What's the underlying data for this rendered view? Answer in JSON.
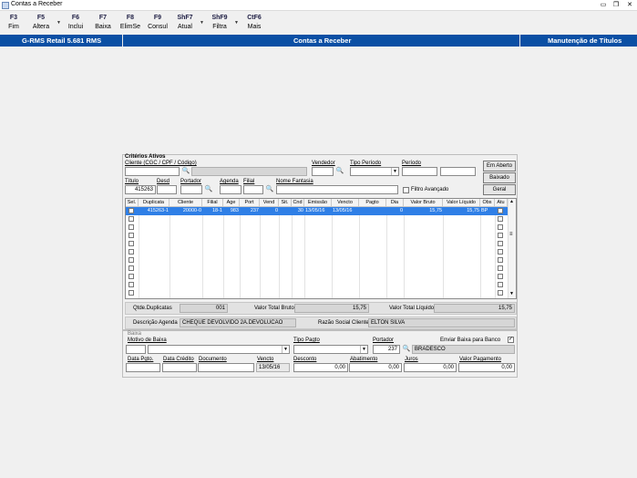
{
  "window": {
    "title": "Contas a Receber"
  },
  "toolbar": [
    {
      "key": "F3",
      "label": "Fim"
    },
    {
      "key": "F5",
      "label": "Altera"
    },
    {
      "key": "F6",
      "label": "Inclui"
    },
    {
      "key": "F7",
      "label": "Baixa"
    },
    {
      "key": "F8",
      "label": "ElimSe"
    },
    {
      "key": "F9",
      "label": "Consul"
    },
    {
      "key": "ShF7",
      "label": "Atual"
    },
    {
      "key": "ShF9",
      "label": "Filtra"
    },
    {
      "key": "CtF6",
      "label": "Mais"
    }
  ],
  "header": {
    "left": "G-RMS Retail 5.681 RMS",
    "center": "Contas a Receber",
    "right": "Manutenção de Títulos"
  },
  "criteria": {
    "title": "Critérios Ativos",
    "cliente_label": "Cliente (CGC / CPF / Código)",
    "vendedor_label": "Vendedor",
    "tipo_periodo_label": "Tipo Período",
    "periodo_label": "Período",
    "titulo_label": "Título",
    "titulo_value": "415263",
    "desd_label": "Desd",
    "portador_label": "Portador",
    "agenda_label": "Agenda",
    "filial_label": "Filial",
    "nome_fantasia_label": "Nome Fantasia",
    "filtro_avancado_label": "Filtro Avançado",
    "btn_em_aberto": "Em Aberto",
    "btn_baixado": "Baixado",
    "btn_geral": "Geral"
  },
  "grid": {
    "columns": [
      "Sel.",
      "Duplicata",
      "Cliente",
      "Filial",
      "Age",
      "Port",
      "Vend",
      "Sit.",
      "Cnd",
      "Emissão",
      "Vencto",
      "Pagto",
      "Dia",
      "Valor Bruto",
      "Valor Líquido",
      "Obs",
      "Atu"
    ],
    "rows": [
      {
        "duplicata": "415263-1",
        "cliente": "20000-0",
        "filial": "18-1",
        "age": "983",
        "port": "237",
        "vend": "0",
        "cnd": "30",
        "emissao": "13/05/16",
        "vencto": "13/05/16",
        "pagto": "",
        "dia": "0",
        "bruto": "15,75",
        "liquido": "15,75",
        "obs": "BP"
      }
    ]
  },
  "totals": {
    "qtde_label": "Qtde.Duplicatas",
    "qtde_value": "001",
    "bruto_label": "Valor Total Bruto",
    "bruto_value": "15,75",
    "liquido_label": "Valor Total Líquido",
    "liquido_value": "15,75",
    "descricao_label": "Descrição Agenda",
    "descricao_value": "CHEQUE DEVOLVIDO 2A.DEVOLUCAO",
    "razao_label": "Razão Social Cliente",
    "razao_value": "ELTON SILVA"
  },
  "baixa": {
    "title": "Baixa",
    "motivo_label": "Motivo de Baixa",
    "tipo_pagto_label": "Tipo Pagto",
    "portador_label": "Portador",
    "portador_value": "237",
    "portador_name": "BRADESCO",
    "enviar_label": "Enviar Baixa para Banco",
    "data_pgto_label": "Data Pgto.",
    "data_credito_label": "Data Crédito",
    "documento_label": "Documento",
    "vencto_label": "Vencto",
    "vencto_value": "13/05/16",
    "desconto_label": "Desconto",
    "desconto_value": "0,00",
    "abatimento_label": "Abatimento",
    "abatimento_value": "0,00",
    "juros_label": "Juros",
    "juros_value": "0,00",
    "valor_pag_label": "Valor Pagamento",
    "valor_pag_value": "0,00"
  }
}
